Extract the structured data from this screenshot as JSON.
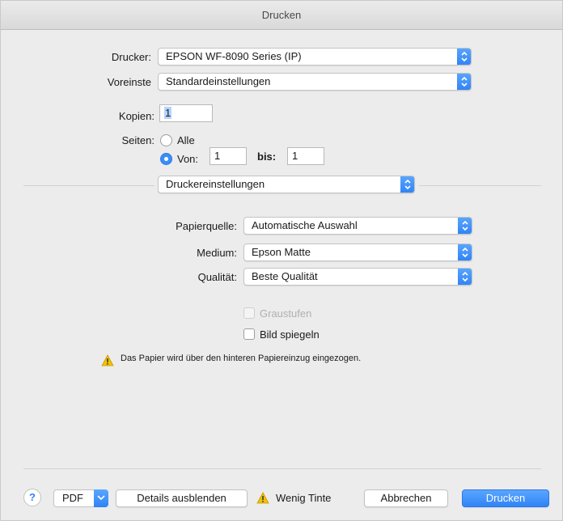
{
  "window": {
    "title": "Drucken"
  },
  "printer": {
    "label": "Drucker:",
    "value": "EPSON WF-8090 Series (IP)"
  },
  "presets": {
    "label": "Voreinste",
    "value": "Standardeinstellungen"
  },
  "copies": {
    "label": "Kopien:",
    "value": "1"
  },
  "pages": {
    "label": "Seiten:",
    "all_label": "Alle",
    "from_label": "Von:",
    "from_value": "1",
    "to_label": "bis:",
    "to_value": "1",
    "selected": "from"
  },
  "section": {
    "value": "Druckereinstellungen"
  },
  "settings": {
    "paper_source": {
      "label": "Papierquelle:",
      "value": "Automatische Auswahl"
    },
    "medium": {
      "label": "Medium:",
      "value": "Epson Matte"
    },
    "quality": {
      "label": "Qualität:",
      "value": "Beste Qualität"
    }
  },
  "options": {
    "grayscale": {
      "label": "Graustufen",
      "checked": false,
      "enabled": false
    },
    "mirror": {
      "label": "Bild spiegeln",
      "checked": false,
      "enabled": true
    }
  },
  "warning": {
    "text": "Das Papier wird über den hinteren Papiereinzug eingezogen."
  },
  "footer": {
    "help_label": "?",
    "pdf_label": "PDF",
    "details_label": "Details ausblenden",
    "ink_label": "Wenig Tinte",
    "cancel_label": "Abbrechen",
    "print_label": "Drucken"
  },
  "colors": {
    "accent": "#2f83f6",
    "warning": "#f2c200"
  }
}
